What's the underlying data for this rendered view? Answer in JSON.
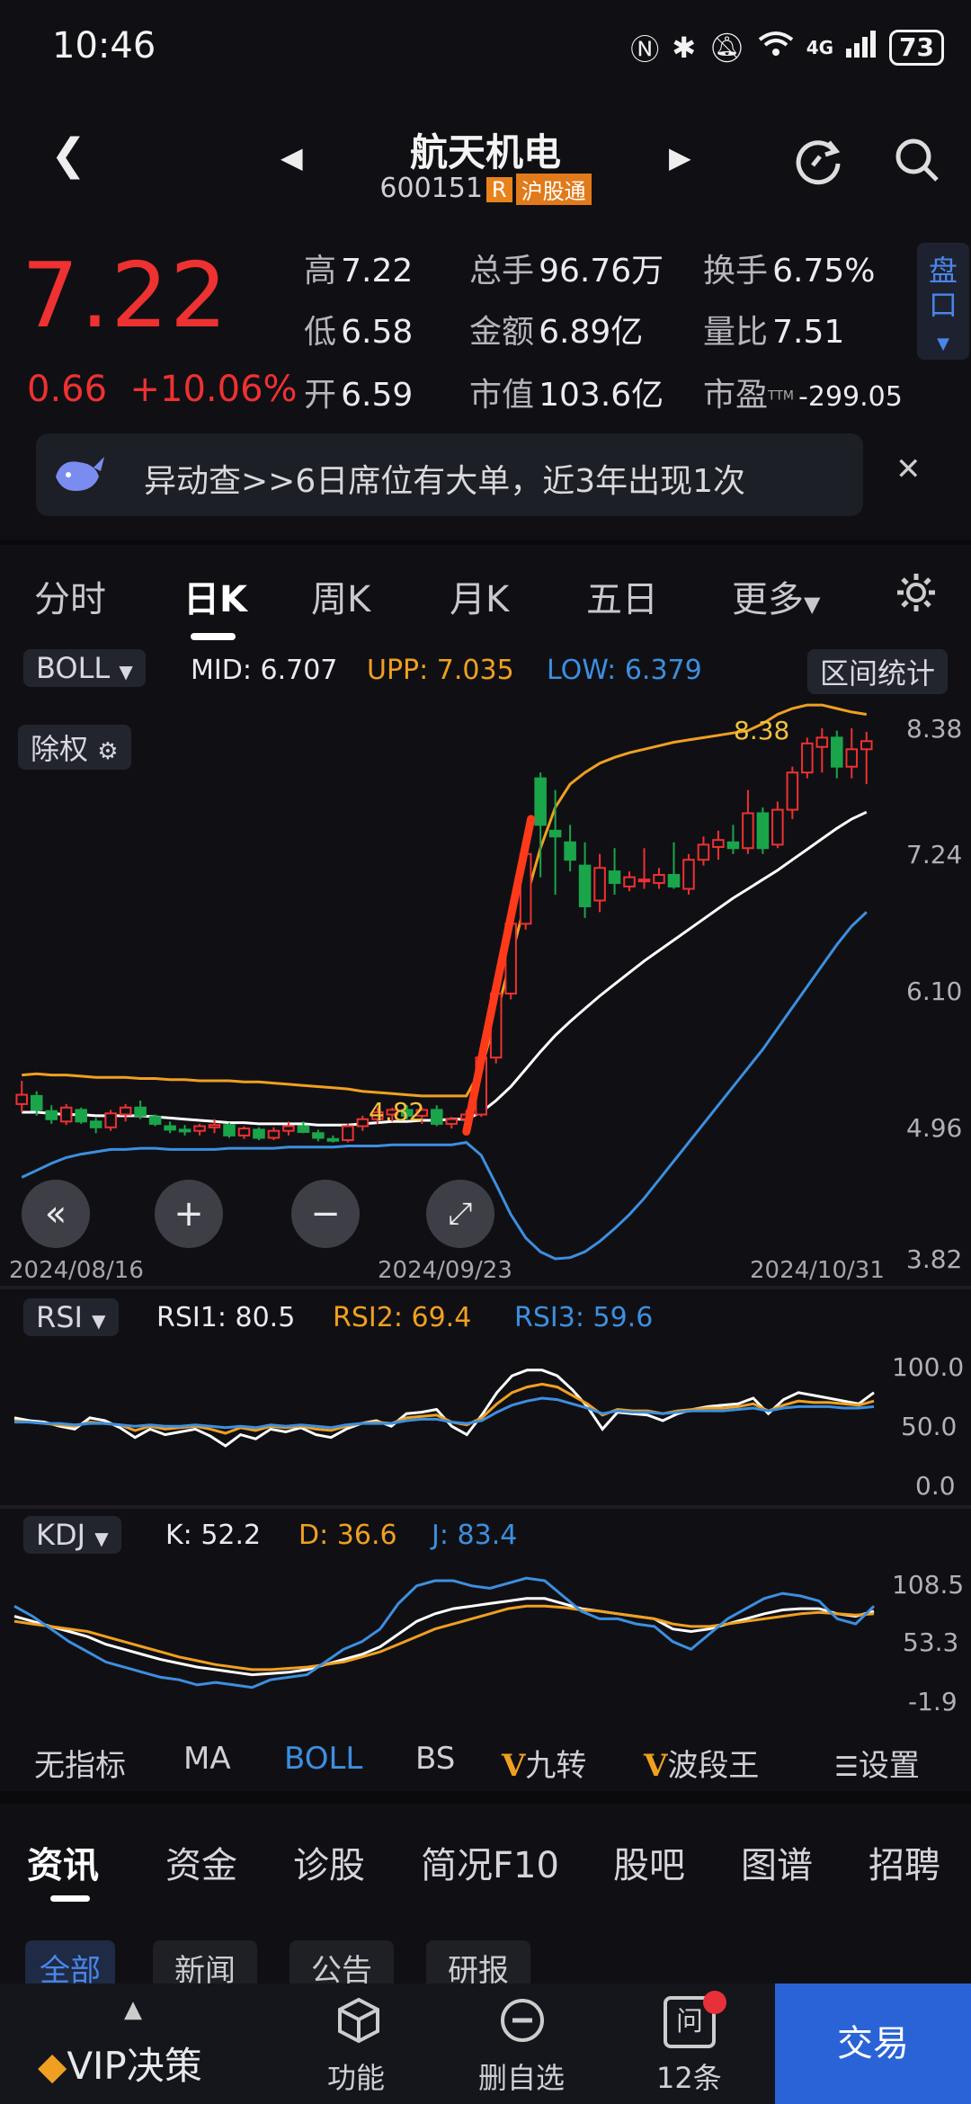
{
  "status_bar": {
    "time": "10:46",
    "battery": "73",
    "network": "4G"
  },
  "header": {
    "title": "航天机电",
    "code": "600151",
    "r_badge": "R",
    "market_badge": "沪股通"
  },
  "quote": {
    "price": "7.22",
    "change": "0.66",
    "change_pct": "+10.06%",
    "high_label": "高",
    "high": "7.22",
    "low_label": "低",
    "low": "6.58",
    "open_label": "开",
    "open": "6.59",
    "volume_label": "总手",
    "volume": "96.76万",
    "amount_label": "金额",
    "amount": "6.89亿",
    "mcap_label": "市值",
    "mcap": "103.6亿",
    "turnover_label": "换手",
    "turnover": "6.75%",
    "vol_ratio_label": "量比",
    "vol_ratio": "7.51",
    "pe_label": "市盈",
    "pe_sup": "TTM",
    "pe": "-299.05",
    "pankou_label": "盘口"
  },
  "alert": {
    "text": "异动查>>6日席位有大单，近3年出现1次"
  },
  "tabs": [
    "分时",
    "日K",
    "周K",
    "月K",
    "五日",
    "更多"
  ],
  "boll": {
    "indicator": "BOLL",
    "mid_label": "MID:",
    "mid": "6.707",
    "upp_label": "UPP:",
    "upp": "7.035",
    "low_label": "LOW:",
    "low": "6.379",
    "range_stats": "区间统计",
    "adjust": "除权",
    "max_marker": "8.38",
    "min_marker": "4.82",
    "y_ticks": [
      "8.38",
      "7.24",
      "6.10",
      "4.96",
      "3.82"
    ],
    "dates": [
      "2024/08/16",
      "2024/09/23",
      "2024/10/31"
    ]
  },
  "rsi": {
    "indicator": "RSI",
    "rsi1_label": "RSI1:",
    "rsi1": "80.5",
    "rsi2_label": "RSI2:",
    "rsi2": "69.4",
    "rsi3_label": "RSI3:",
    "rsi3": "59.6",
    "y_ticks": [
      "100.0",
      "50.0",
      "0.0"
    ]
  },
  "kdj": {
    "indicator": "KDJ",
    "k_label": "K:",
    "k": "52.2",
    "d_label": "D:",
    "d": "36.6",
    "j_label": "J:",
    "j": "83.4",
    "y_ticks": [
      "108.5",
      "53.3",
      "-1.9"
    ]
  },
  "indicator_bar": [
    "无指标",
    "MA",
    "BOLL",
    "BS",
    "九转",
    "波段王",
    "设置"
  ],
  "news_tabs": [
    "资讯",
    "资金",
    "诊股",
    "简况F10",
    "股吧",
    "图谱",
    "招聘"
  ],
  "news_subtabs": [
    "全部",
    "新闻",
    "公告",
    "研报"
  ],
  "bottom_nav": {
    "vip": "VIP决策",
    "func": "功能",
    "remove": "删自选",
    "ask": "12条",
    "ask_icon": "问",
    "trade": "交易"
  },
  "colors": {
    "up": "#ee3131",
    "down": "#1aa54b",
    "mid": "#ffffff",
    "upper": "#f0a020",
    "lower": "#3d8fe0",
    "accent": "#2a63d6"
  },
  "chart_data": [
    {
      "type": "candlestick",
      "title": "",
      "x_range": [
        "2024/08/16",
        "2024/10/31"
      ],
      "ylim": [
        3.82,
        8.38
      ],
      "candles": [
        {
          "o": 5.15,
          "h": 5.35,
          "l": 5.08,
          "c": 5.23
        },
        {
          "o": 5.22,
          "h": 5.26,
          "l": 5.05,
          "c": 5.1
        },
        {
          "o": 5.09,
          "h": 5.14,
          "l": 4.98,
          "c": 5.02
        },
        {
          "o": 5.0,
          "h": 5.15,
          "l": 4.97,
          "c": 5.12
        },
        {
          "o": 5.1,
          "h": 5.12,
          "l": 4.98,
          "c": 5.0
        },
        {
          "o": 5.0,
          "h": 5.03,
          "l": 4.9,
          "c": 4.95
        },
        {
          "o": 4.95,
          "h": 5.1,
          "l": 4.92,
          "c": 5.07
        },
        {
          "o": 5.06,
          "h": 5.15,
          "l": 5.0,
          "c": 5.12
        },
        {
          "o": 5.12,
          "h": 5.18,
          "l": 5.02,
          "c": 5.05
        },
        {
          "o": 5.04,
          "h": 5.06,
          "l": 4.96,
          "c": 4.98
        },
        {
          "o": 4.96,
          "h": 5.0,
          "l": 4.9,
          "c": 4.93
        },
        {
          "o": 4.93,
          "h": 4.97,
          "l": 4.88,
          "c": 4.92
        },
        {
          "o": 4.92,
          "h": 4.98,
          "l": 4.88,
          "c": 4.96
        },
        {
          "o": 4.95,
          "h": 5.02,
          "l": 4.9,
          "c": 4.97
        },
        {
          "o": 4.97,
          "h": 4.99,
          "l": 4.86,
          "c": 4.88
        },
        {
          "o": 4.88,
          "h": 4.96,
          "l": 4.85,
          "c": 4.94
        },
        {
          "o": 4.93,
          "h": 4.95,
          "l": 4.84,
          "c": 4.86
        },
        {
          "o": 4.86,
          "h": 4.95,
          "l": 4.84,
          "c": 4.92
        },
        {
          "o": 4.92,
          "h": 5.0,
          "l": 4.88,
          "c": 4.96
        },
        {
          "o": 4.96,
          "h": 5.0,
          "l": 4.9,
          "c": 4.91
        },
        {
          "o": 4.9,
          "h": 4.93,
          "l": 4.83,
          "c": 4.86
        },
        {
          "o": 4.85,
          "h": 4.88,
          "l": 4.82,
          "c": 4.84
        },
        {
          "o": 4.84,
          "h": 4.98,
          "l": 4.82,
          "c": 4.96
        },
        {
          "o": 4.96,
          "h": 5.05,
          "l": 4.92,
          "c": 5.02
        },
        {
          "o": 5.02,
          "h": 5.12,
          "l": 4.98,
          "c": 5.08
        },
        {
          "o": 5.06,
          "h": 5.12,
          "l": 5.0,
          "c": 5.1
        },
        {
          "o": 5.1,
          "h": 5.14,
          "l": 5.02,
          "c": 5.05
        },
        {
          "o": 5.05,
          "h": 5.12,
          "l": 4.98,
          "c": 5.1
        },
        {
          "o": 5.1,
          "h": 5.14,
          "l": 4.96,
          "c": 4.98
        },
        {
          "o": 4.98,
          "h": 5.04,
          "l": 4.94,
          "c": 5.02
        },
        {
          "o": 5.02,
          "h": 5.1,
          "l": 4.96,
          "c": 5.06
        },
        {
          "o": 5.06,
          "h": 5.5,
          "l": 5.04,
          "c": 5.55
        },
        {
          "o": 5.55,
          "h": 6.05,
          "l": 5.5,
          "c": 6.1
        },
        {
          "o": 6.1,
          "h": 6.6,
          "l": 6.05,
          "c": 6.7
        },
        {
          "o": 6.7,
          "h": 7.5,
          "l": 6.65,
          "c": 7.3
        },
        {
          "o": 7.95,
          "h": 8.0,
          "l": 7.1,
          "c": 7.55
        },
        {
          "o": 7.5,
          "h": 7.85,
          "l": 6.95,
          "c": 7.45
        },
        {
          "o": 7.4,
          "h": 7.55,
          "l": 7.15,
          "c": 7.25
        },
        {
          "o": 7.2,
          "h": 7.4,
          "l": 6.75,
          "c": 6.85
        },
        {
          "o": 6.9,
          "h": 7.3,
          "l": 6.8,
          "c": 7.18
        },
        {
          "o": 7.15,
          "h": 7.35,
          "l": 6.95,
          "c": 7.05
        },
        {
          "o": 7.02,
          "h": 7.15,
          "l": 6.98,
          "c": 7.1
        },
        {
          "o": 7.08,
          "h": 7.35,
          "l": 7.0,
          "c": 7.08
        },
        {
          "o": 7.05,
          "h": 7.18,
          "l": 7.0,
          "c": 7.12
        },
        {
          "o": 7.12,
          "h": 7.4,
          "l": 7.0,
          "c": 7.02
        },
        {
          "o": 7.0,
          "h": 7.3,
          "l": 6.95,
          "c": 7.25
        },
        {
          "o": 7.25,
          "h": 7.45,
          "l": 7.2,
          "c": 7.38
        },
        {
          "o": 7.36,
          "h": 7.5,
          "l": 7.25,
          "c": 7.42
        },
        {
          "o": 7.4,
          "h": 7.55,
          "l": 7.3,
          "c": 7.35
        },
        {
          "o": 7.35,
          "h": 7.85,
          "l": 7.3,
          "c": 7.65
        },
        {
          "o": 7.65,
          "h": 7.7,
          "l": 7.3,
          "c": 7.35
        },
        {
          "o": 7.38,
          "h": 7.75,
          "l": 7.35,
          "c": 7.68
        },
        {
          "o": 7.68,
          "h": 8.05,
          "l": 7.6,
          "c": 8.0
        },
        {
          "o": 8.0,
          "h": 8.3,
          "l": 7.95,
          "c": 8.25
        },
        {
          "o": 8.22,
          "h": 8.38,
          "l": 8.0,
          "c": 8.3
        },
        {
          "o": 8.3,
          "h": 8.36,
          "l": 7.95,
          "c": 8.05
        },
        {
          "o": 8.05,
          "h": 8.38,
          "l": 7.95,
          "c": 8.2
        },
        {
          "o": 8.2,
          "h": 8.35,
          "l": 7.9,
          "c": 8.27
        }
      ],
      "mid": [
        5.08,
        5.08,
        5.07,
        5.06,
        5.06,
        5.05,
        5.05,
        5.05,
        5.05,
        5.04,
        5.03,
        5.02,
        5.01,
        5.0,
        4.99,
        4.99,
        4.98,
        4.98,
        4.98,
        4.98,
        4.97,
        4.97,
        4.97,
        4.98,
        4.99,
        5.0,
        5.0,
        5.01,
        5.01,
        5.02,
        5.02,
        5.08,
        5.18,
        5.3,
        5.45,
        5.6,
        5.74,
        5.86,
        5.97,
        6.08,
        6.18,
        6.28,
        6.38,
        6.47,
        6.56,
        6.65,
        6.74,
        6.83,
        6.92,
        7.0,
        7.08,
        7.16,
        7.25,
        7.34,
        7.43,
        7.52,
        7.6,
        7.66
      ],
      "upper": [
        5.4,
        5.41,
        5.4,
        5.4,
        5.39,
        5.38,
        5.38,
        5.38,
        5.37,
        5.37,
        5.36,
        5.36,
        5.35,
        5.35,
        5.35,
        5.34,
        5.34,
        5.33,
        5.32,
        5.31,
        5.3,
        5.29,
        5.28,
        5.26,
        5.25,
        5.24,
        5.23,
        5.22,
        5.22,
        5.22,
        5.22,
        5.45,
        5.9,
        6.4,
        6.9,
        7.35,
        7.7,
        7.9,
        8.0,
        8.08,
        8.13,
        8.17,
        8.2,
        8.23,
        8.26,
        8.28,
        8.3,
        8.32,
        8.34,
        8.36,
        8.42,
        8.5,
        8.55,
        8.58,
        8.58,
        8.55,
        8.52,
        8.5
      ],
      "lower": [
        4.52,
        4.58,
        4.64,
        4.69,
        4.72,
        4.74,
        4.76,
        4.76,
        4.77,
        4.77,
        4.76,
        4.76,
        4.76,
        4.76,
        4.77,
        4.77,
        4.77,
        4.77,
        4.78,
        4.78,
        4.78,
        4.78,
        4.79,
        4.79,
        4.79,
        4.8,
        4.8,
        4.8,
        4.8,
        4.8,
        4.82,
        4.71,
        4.46,
        4.2,
        4.0,
        3.88,
        3.82,
        3.83,
        3.88,
        3.97,
        4.08,
        4.2,
        4.34,
        4.5,
        4.66,
        4.82,
        4.98,
        5.14,
        5.3,
        5.46,
        5.62,
        5.8,
        5.98,
        6.16,
        6.34,
        6.52,
        6.68,
        6.8
      ]
    },
    {
      "type": "line",
      "title": "",
      "ylim": [
        0,
        100
      ],
      "series": [
        {
          "name": "RSI1",
          "values": [
            52,
            50,
            49,
            46,
            44,
            52,
            50,
            45,
            38,
            44,
            40,
            42,
            44,
            39,
            32,
            40,
            37,
            44,
            42,
            45,
            40,
            38,
            44,
            48,
            50,
            46,
            55,
            56,
            58,
            46,
            40,
            54,
            70,
            82,
            86,
            86,
            82,
            72,
            60,
            44,
            56,
            55,
            54,
            50,
            55,
            58,
            60,
            61,
            62,
            66,
            55,
            65,
            70,
            68,
            66,
            64,
            62,
            70
          ]
        },
        {
          "name": "RSI2",
          "values": [
            50,
            49,
            48,
            47,
            46,
            49,
            48,
            47,
            43,
            46,
            44,
            45,
            46,
            44,
            41,
            45,
            43,
            46,
            45,
            46,
            44,
            43,
            46,
            48,
            49,
            48,
            52,
            53,
            54,
            49,
            47,
            52,
            62,
            70,
            74,
            76,
            74,
            68,
            62,
            54,
            58,
            57,
            57,
            55,
            57,
            58,
            59,
            59,
            60,
            62,
            57,
            61,
            64,
            63,
            63,
            62,
            61,
            64
          ]
        },
        {
          "name": "RSI3",
          "values": [
            49,
            49,
            48,
            48,
            47,
            48,
            48,
            47,
            46,
            47,
            46,
            46,
            47,
            46,
            45,
            46,
            45,
            47,
            46,
            47,
            46,
            45,
            47,
            48,
            48,
            48,
            50,
            51,
            51,
            49,
            48,
            50,
            56,
            61,
            64,
            66,
            65,
            62,
            59,
            55,
            57,
            56,
            56,
            55,
            56,
            57,
            57,
            57,
            58,
            59,
            57,
            59,
            60,
            60,
            60,
            59,
            59,
            60
          ]
        }
      ]
    },
    {
      "type": "line",
      "title": "",
      "ylim": [
        -1.9,
        108.5
      ],
      "series": [
        {
          "name": "K",
          "values": [
            72,
            68,
            64,
            60,
            56,
            50,
            46,
            42,
            38,
            35,
            32,
            30,
            28,
            26,
            27,
            28,
            30,
            34,
            38,
            42,
            48,
            58,
            68,
            74,
            78,
            80,
            82,
            84,
            86,
            86,
            82,
            78,
            76,
            74,
            72,
            70,
            62,
            60,
            62,
            66,
            70,
            74,
            77,
            78,
            78,
            74,
            72,
            76
          ]
        },
        {
          "name": "D",
          "values": [
            68,
            66,
            64,
            62,
            60,
            56,
            52,
            48,
            44,
            40,
            37,
            34,
            32,
            30,
            30,
            31,
            32,
            34,
            36,
            40,
            44,
            50,
            56,
            62,
            66,
            70,
            74,
            78,
            80,
            80,
            79,
            77,
            76,
            74,
            72,
            70,
            66,
            64,
            64,
            66,
            68,
            70,
            72,
            74,
            75,
            74,
            73,
            74
          ]
        },
        {
          "name": "J",
          "values": [
            80,
            72,
            62,
            52,
            44,
            36,
            32,
            28,
            24,
            22,
            18,
            20,
            18,
            16,
            22,
            24,
            26,
            36,
            46,
            52,
            62,
            82,
            96,
            100,
            100,
            96,
            94,
            98,
            102,
            100,
            88,
            76,
            70,
            70,
            66,
            64,
            52,
            46,
            58,
            70,
            78,
            86,
            90,
            88,
            84,
            70,
            66,
            80
          ]
        }
      ]
    }
  ]
}
